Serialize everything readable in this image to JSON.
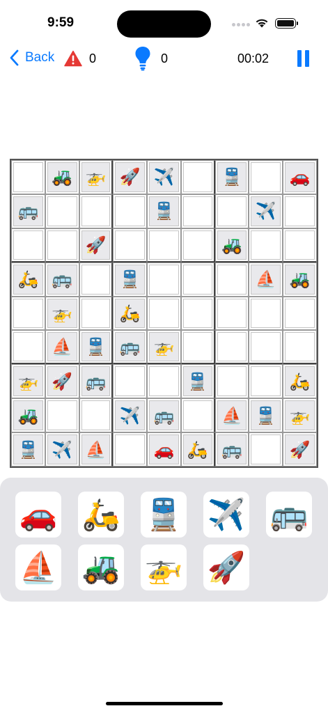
{
  "status_bar": {
    "time": "9:59"
  },
  "toolbar": {
    "back_label": "Back",
    "mistakes_count": "0",
    "hints_count": "0",
    "timer": "00:02",
    "accent_color": "#0a7aff",
    "warning_color": "#e53935"
  },
  "symbols": {
    "car": "🚗",
    "scooter": "🛵",
    "train": "🚆",
    "plane": "✈️",
    "bus": "🚌",
    "sailboat": "⛵",
    "tractor": "🚜",
    "helicopter": "🚁",
    "rocket": "🚀"
  },
  "board": {
    "rows": [
      [
        {
          "v": "",
          "given": false
        },
        {
          "v": "tractor",
          "given": true
        },
        {
          "v": "helicopter",
          "given": true
        },
        {
          "v": "rocket",
          "given": true
        },
        {
          "v": "plane",
          "given": true
        },
        {
          "v": "",
          "given": false
        },
        {
          "v": "train",
          "given": true
        },
        {
          "v": "",
          "given": false
        },
        {
          "v": "car",
          "given": true
        }
      ],
      [
        {
          "v": "bus",
          "given": true
        },
        {
          "v": "",
          "given": false
        },
        {
          "v": "",
          "given": false
        },
        {
          "v": "",
          "given": false
        },
        {
          "v": "train",
          "given": true
        },
        {
          "v": "",
          "given": false
        },
        {
          "v": "",
          "given": false
        },
        {
          "v": "plane",
          "given": true
        },
        {
          "v": "",
          "given": false
        }
      ],
      [
        {
          "v": "",
          "given": false
        },
        {
          "v": "",
          "given": false
        },
        {
          "v": "rocket",
          "given": true
        },
        {
          "v": "",
          "given": false
        },
        {
          "v": "",
          "given": false
        },
        {
          "v": "",
          "given": false
        },
        {
          "v": "tractor",
          "given": true
        },
        {
          "v": "",
          "given": false
        },
        {
          "v": "",
          "given": false
        }
      ],
      [
        {
          "v": "scooter",
          "given": true
        },
        {
          "v": "bus",
          "given": true
        },
        {
          "v": "",
          "given": false
        },
        {
          "v": "train",
          "given": true
        },
        {
          "v": "",
          "given": false
        },
        {
          "v": "",
          "given": false
        },
        {
          "v": "",
          "given": false
        },
        {
          "v": "sailboat",
          "given": true
        },
        {
          "v": "tractor",
          "given": true
        }
      ],
      [
        {
          "v": "",
          "given": false
        },
        {
          "v": "helicopter",
          "given": true
        },
        {
          "v": "",
          "given": false
        },
        {
          "v": "scooter",
          "given": true
        },
        {
          "v": "",
          "given": false
        },
        {
          "v": "",
          "given": false
        },
        {
          "v": "",
          "given": false
        },
        {
          "v": "",
          "given": false
        },
        {
          "v": "",
          "given": false
        }
      ],
      [
        {
          "v": "",
          "given": false
        },
        {
          "v": "sailboat",
          "given": true
        },
        {
          "v": "train",
          "given": true
        },
        {
          "v": "bus",
          "given": true
        },
        {
          "v": "helicopter",
          "given": true
        },
        {
          "v": "",
          "given": false
        },
        {
          "v": "",
          "given": false
        },
        {
          "v": "",
          "given": false
        },
        {
          "v": "",
          "given": false
        }
      ],
      [
        {
          "v": "helicopter",
          "given": true
        },
        {
          "v": "rocket",
          "given": true
        },
        {
          "v": "bus",
          "given": true
        },
        {
          "v": "",
          "given": false
        },
        {
          "v": "",
          "given": false
        },
        {
          "v": "train",
          "given": true
        },
        {
          "v": "",
          "given": false
        },
        {
          "v": "",
          "given": false
        },
        {
          "v": "scooter",
          "given": true
        }
      ],
      [
        {
          "v": "tractor",
          "given": true
        },
        {
          "v": "",
          "given": false
        },
        {
          "v": "",
          "given": false
        },
        {
          "v": "plane",
          "given": true
        },
        {
          "v": "bus",
          "given": true
        },
        {
          "v": "",
          "given": false
        },
        {
          "v": "sailboat",
          "given": true
        },
        {
          "v": "train",
          "given": true
        },
        {
          "v": "helicopter",
          "given": true
        }
      ],
      [
        {
          "v": "train",
          "given": true
        },
        {
          "v": "plane",
          "given": true
        },
        {
          "v": "sailboat",
          "given": true
        },
        {
          "v": "",
          "given": false
        },
        {
          "v": "car",
          "given": true
        },
        {
          "v": "scooter",
          "given": true
        },
        {
          "v": "bus",
          "given": true
        },
        {
          "v": "",
          "given": false
        },
        {
          "v": "rocket",
          "given": true
        }
      ]
    ]
  },
  "palette": [
    "car",
    "scooter",
    "train",
    "plane",
    "bus",
    "sailboat",
    "tractor",
    "helicopter",
    "rocket"
  ]
}
